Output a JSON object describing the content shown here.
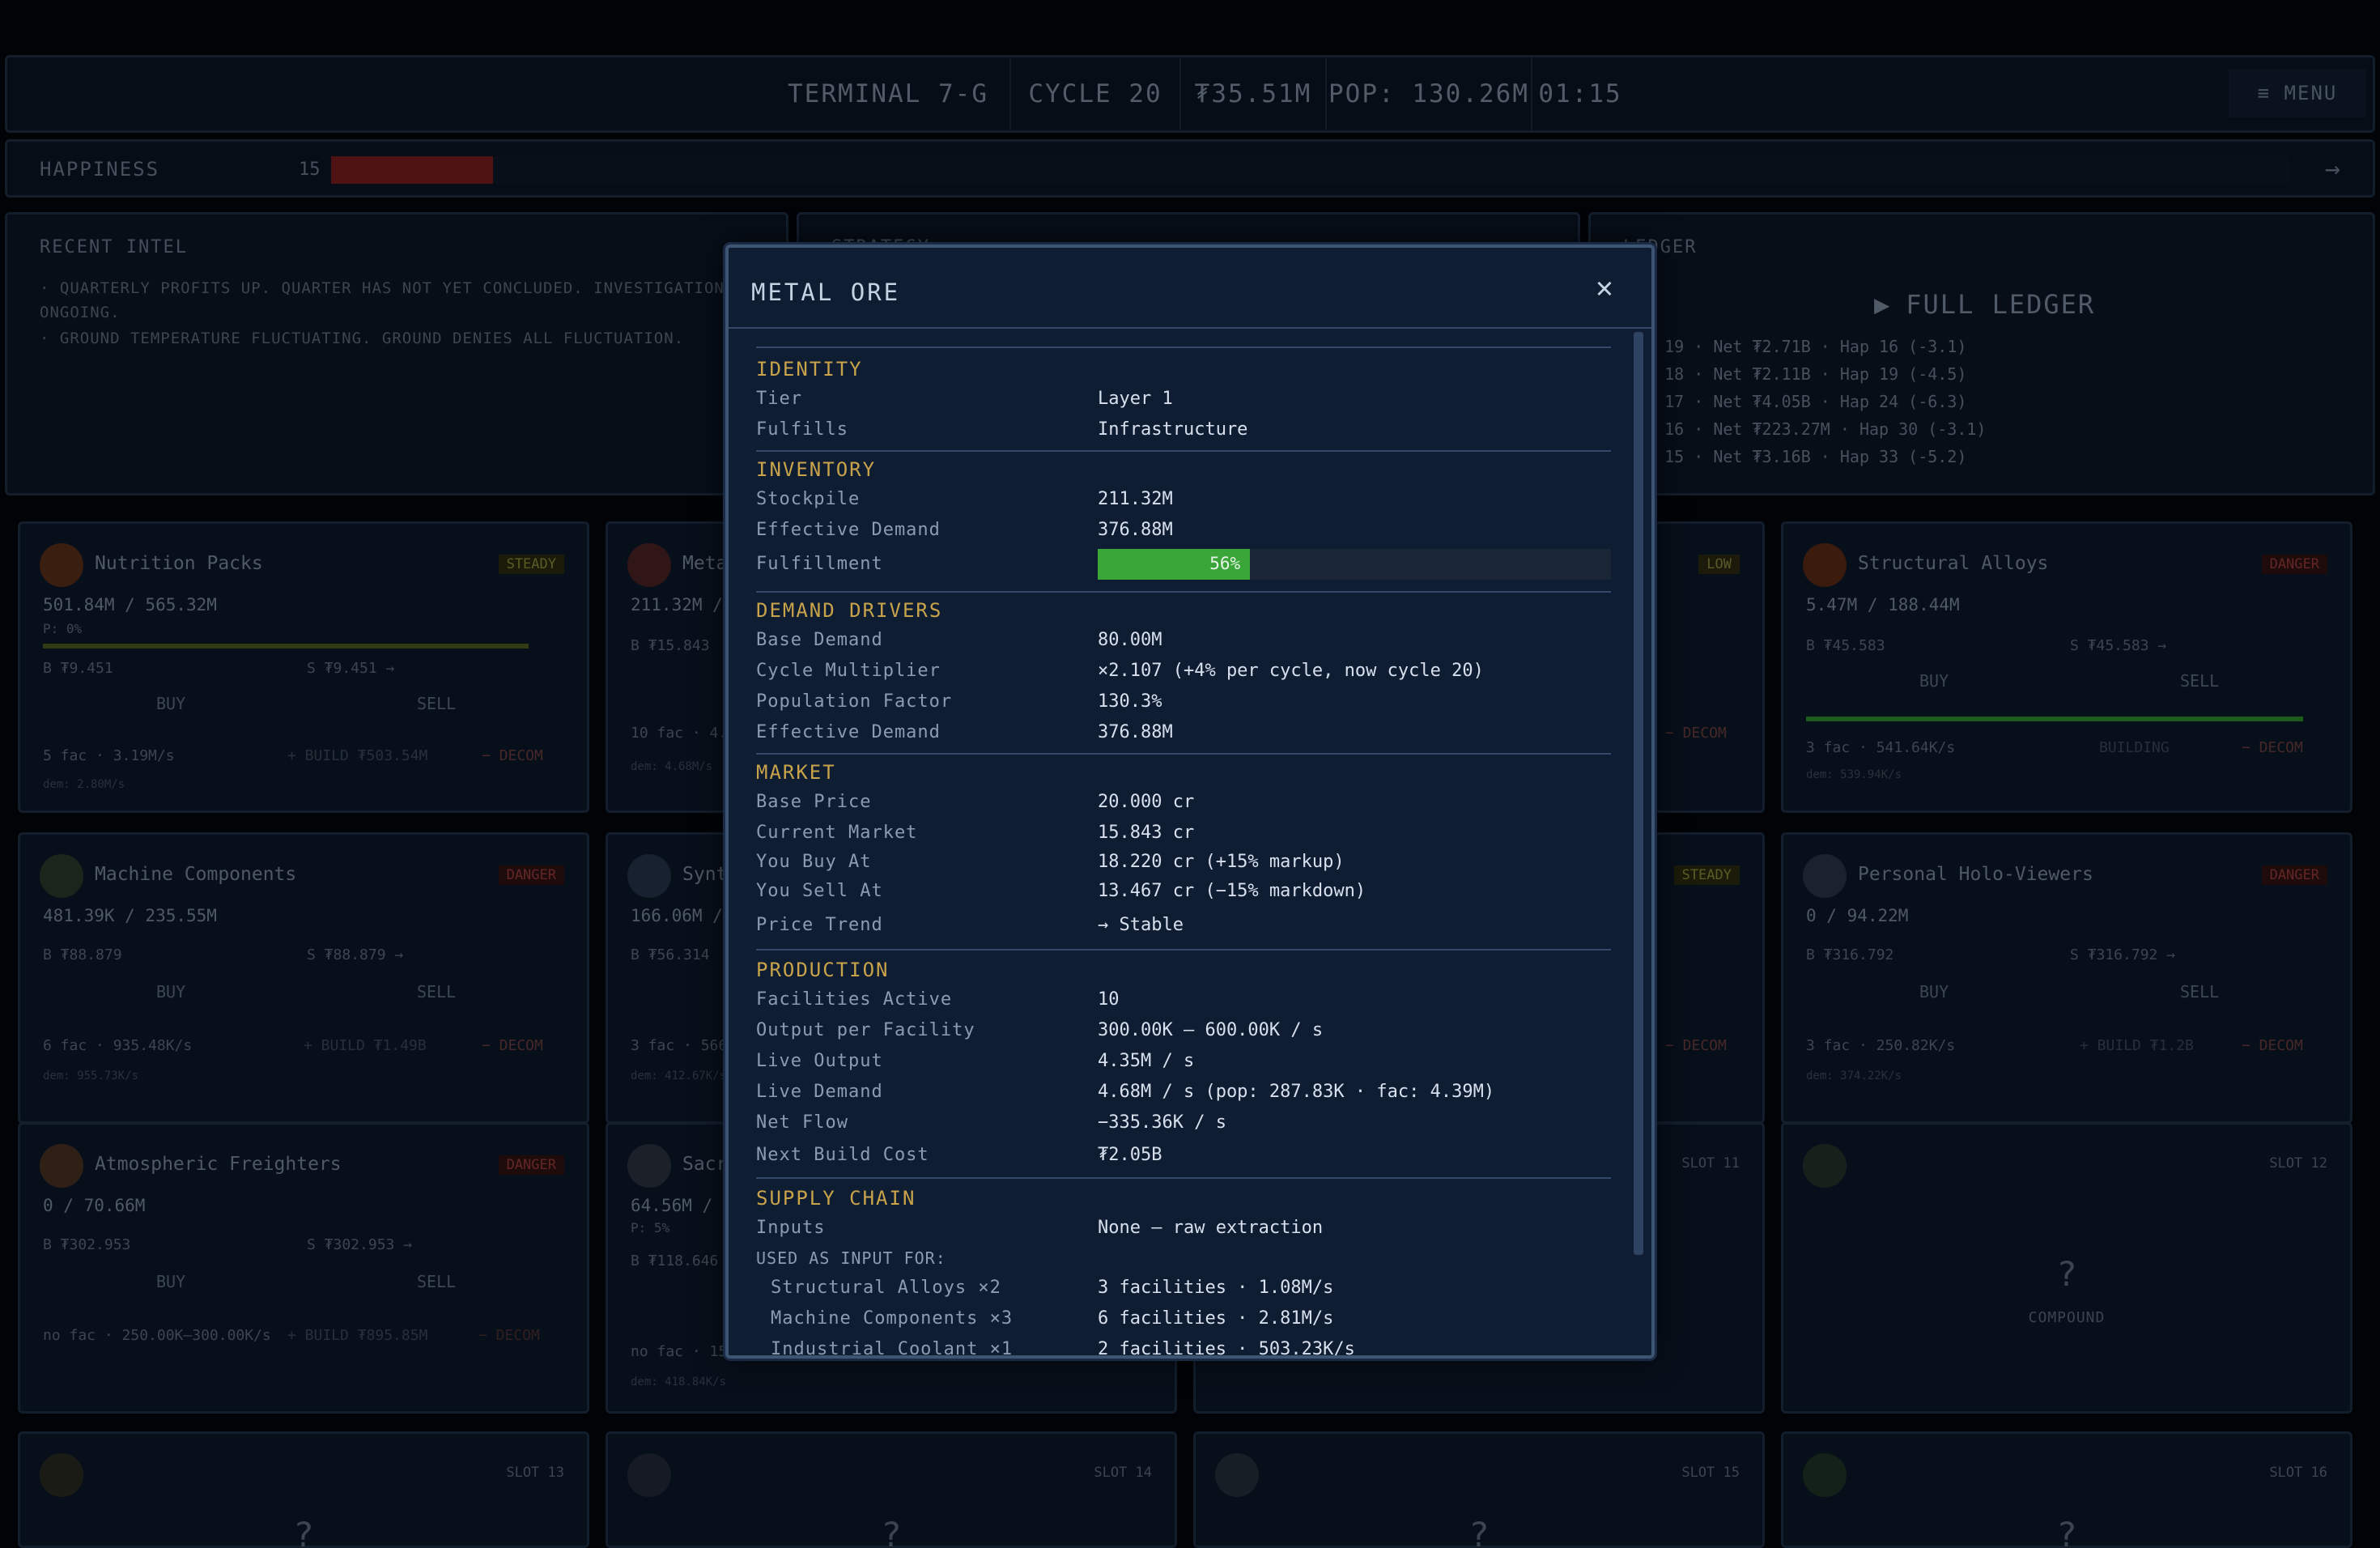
{
  "topbar": {
    "terminal": "TERMINAL 7-G",
    "cycle": "CYCLE 20",
    "money": "₮35.51M",
    "pop": "POP: 130.26M",
    "time": "01:15",
    "menu": "≡ MENU"
  },
  "happiness": {
    "label": "HAPPINESS",
    "value": "15",
    "fill_percent": 15,
    "arrow": "→"
  },
  "intel": {
    "title": "RECENT INTEL",
    "lines": [
      "· QUARTERLY PROFITS UP. QUARTER HAS NOT YET CONCLUDED. INVESTIGATION ONGOING.",
      "· GROUND TEMPERATURE FLUCTUATING. GROUND DENIES ALL FLUCTUATION."
    ]
  },
  "middle_panel": {
    "title": "STRATEGY"
  },
  "ledger": {
    "title": "LEDGER",
    "full_ledger": "FULL LEDGER",
    "rows": [
      "LE 19 · Net ₮2.71B · Hap 16 (-3.1)",
      "LE 18 · Net ₮2.11B · Hap 19 (-4.5)",
      "LE 17 · Net ₮4.05B · Hap 24 (-6.3)",
      "LE 16 · Net ₮223.27M · Hap 30 (-3.1)",
      "LE 15 · Net ₮3.16B · Hap 33 (-5.2)"
    ]
  },
  "cards": {
    "nutrition": {
      "title": "Nutrition Packs",
      "badge": "STEADY",
      "stock": "501.84M / 565.32M",
      "sub": "P: 0%",
      "buy_price": "B ₮9.451",
      "sell_price": "S ₮9.451 →",
      "buy": "BUY",
      "sell": "SELL",
      "foot": "5 fac · 3.19M/s",
      "build": "+ BUILD ₮503.54M",
      "decom": "− DECOM",
      "dem": "dem: 2.80M/s",
      "fill": 0.89
    },
    "metal": {
      "title": "Metal Ore",
      "stock": "211.32M / 3",
      "buy_price": "B ₮15.843",
      "foot": "10 fac · 4.35",
      "dem": "dem: 4.68M/s"
    },
    "structural": {
      "title": "Structural Alloys",
      "badge": "DANGER",
      "stock": "5.47M / 188.44M",
      "buy_price": "B ₮45.583",
      "sell_price": "S ₮45.583 →",
      "buy": "BUY",
      "sell": "SELL",
      "foot": "3 fac · 541.64K/s",
      "build": "BUILDING",
      "decom": "− DECOM",
      "dem": "dem: 539.94K/s",
      "fill": 0.95
    },
    "machine": {
      "title": "Machine Components",
      "badge": "DANGER",
      "stock": "481.39K / 235.55M",
      "buy_price": "B ₮88.879",
      "sell_price": "S ₮88.879 →",
      "buy": "BUY",
      "sell": "SELL",
      "foot": "6 fac · 935.48K/s",
      "build": "+ BUILD ₮1.49B",
      "decom": "− DECOM",
      "dem": "dem: 955.73K/s"
    },
    "synth": {
      "title": "Synt",
      "stock": "166.06M / 2",
      "buy_price": "B ₮56.314",
      "foot": "3 fac · 566.4",
      "dem": "dem: 412.67K/s"
    },
    "holo": {
      "title": "Personal Holo-Viewers",
      "badge": "DANGER",
      "stock": "0 / 94.22M",
      "buy_price": "B ₮316.792",
      "sell_price": "S ₮316.792 →",
      "buy": "BUY",
      "sell": "SELL",
      "foot": "3 fac · 250.82K/s",
      "build": "+ BUILD ₮1.2B",
      "decom": "− DECOM",
      "dem": "dem: 374.22K/s"
    },
    "freighters": {
      "title": "Atmospheric Freighters",
      "badge": "DANGER",
      "stock": "0 / 70.66M",
      "buy_price": "B ₮302.953",
      "sell_price": "S ₮302.953 →",
      "buy": "BUY",
      "sell": "SELL",
      "foot": "no fac · 250.00K—300.00K/s",
      "build": "+ BUILD ₮895.85M",
      "decom": "− DECOM"
    },
    "sacr": {
      "title": "Sacr",
      "stock": "64.56M / 9",
      "sub": "P: 5%",
      "buy_price": "B ₮118.646",
      "foot": "no fac · 150",
      "dem": "dem: 418.84K/s"
    },
    "middle_low": {
      "badge": "LOW",
      "decom": "− DECOM"
    },
    "middle_steady": {
      "badge": "STEADY",
      "decom": "− DECOM"
    },
    "slot11": {
      "slot": "SLOT 11"
    },
    "slot12": {
      "slot": "SLOT 12",
      "q": "?",
      "label": "COMPOUND"
    },
    "slot13": {
      "slot": "SLOT 13",
      "q": "?"
    },
    "slot14": {
      "slot": "SLOT 14",
      "q": "?"
    },
    "slot15": {
      "slot": "SLOT 15",
      "q": "?"
    },
    "slot16": {
      "slot": "SLOT 16",
      "q": "?"
    }
  },
  "modal": {
    "title": "METAL ORE",
    "close": "✕",
    "identity": {
      "head": "IDENTITY",
      "tier_l": "Tier",
      "tier_v": "Layer 1",
      "fulfills_l": "Fulfills",
      "fulfills_v": "Infrastructure"
    },
    "inventory": {
      "head": "INVENTORY",
      "stock_l": "Stockpile",
      "stock_v": "211.32M",
      "eff_l": "Effective Demand",
      "eff_v": "376.88M",
      "ful_l": "Fulfillment",
      "ful_v": "56%",
      "ful_pct": 56
    },
    "demand": {
      "head": "DEMAND DRIVERS",
      "base_l": "Base Demand",
      "base_v": "80.00M",
      "cyc_l": "Cycle Multiplier",
      "cyc_v": "×2.107  (+4% per cycle, now cycle 20)",
      "pop_l": "Population Factor",
      "pop_v": "130.3%",
      "eff_l": "Effective Demand",
      "eff_v": "376.88M"
    },
    "market": {
      "head": "MARKET",
      "bp_l": "Base Price",
      "bp_v": "20.000 cr",
      "cm_l": "Current Market",
      "cm_v": "15.843 cr",
      "yb_l": "You Buy At",
      "yb_v": "18.220 cr  (+15% markup)",
      "ys_l": "You Sell At",
      "ys_v": "13.467 cr  (−15% markdown)",
      "pt_l": "Price Trend",
      "pt_v": "→ Stable"
    },
    "production": {
      "head": "PRODUCTION",
      "fa_l": "Facilities Active",
      "fa_v": "10",
      "opf_l": "Output per Facility",
      "opf_v": "300.00K — 600.00K / s",
      "lo_l": "Live Output",
      "lo_v": "4.35M / s",
      "ld_l": "Live Demand",
      "ld_v": "4.68M / s  (pop: 287.83K · fac: 4.39M)",
      "nf_l": "Net Flow",
      "nf_v": "−335.36K / s",
      "nbc_l": "Next Build Cost",
      "nbc_v": "₮2.05B"
    },
    "supply": {
      "head": "SUPPLY CHAIN",
      "in_l": "Inputs",
      "in_v": "None — raw extraction",
      "used": "USED AS INPUT FOR:",
      "r1_l": "Structural Alloys  ×2",
      "r1_v": "3 facilities · 1.08M/s",
      "r2_l": "Machine Components  ×3",
      "r2_v": "6 facilities · 2.81M/s",
      "r3_l": "Industrial Coolant  ×1",
      "r3_v": "2 facilities · 503.23K/s"
    }
  }
}
